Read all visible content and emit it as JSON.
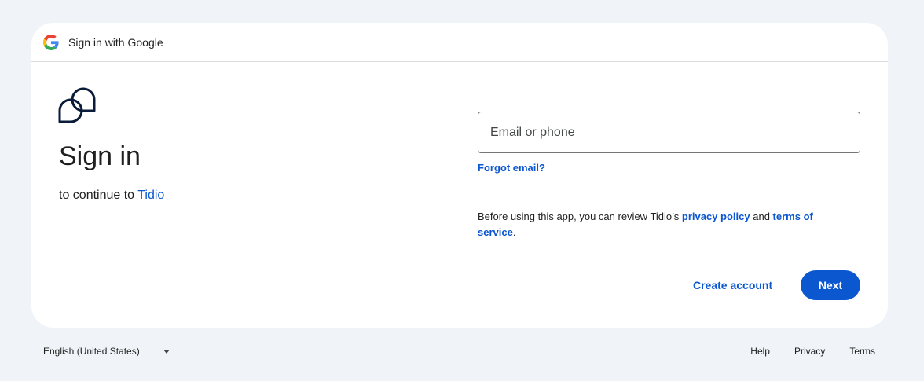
{
  "header": {
    "logo_icon": "google-g-icon",
    "title": "Sign in with Google"
  },
  "left": {
    "app_logo_icon": "tidio-logo-icon",
    "heading": "Sign in",
    "continue_prefix": "to continue to ",
    "app_name": "Tidio"
  },
  "form": {
    "email_placeholder": "Email or phone",
    "email_value": "",
    "forgot_email": "Forgot email?",
    "privacy_prefix": "Before using this app, you can review Tidio’s ",
    "privacy_policy": "privacy policy",
    "privacy_and": " and ",
    "terms_of_service": "terms of service",
    "privacy_suffix": ".",
    "create_account": "Create account",
    "next": "Next"
  },
  "footer": {
    "language": "English (United States)",
    "links": [
      "Help",
      "Privacy",
      "Terms"
    ]
  },
  "colors": {
    "page_background": "#f0f4f9",
    "card_background": "#ffffff",
    "link_blue": "#0b57d0",
    "primary_button": "#0b57d0",
    "text": "#1f1f1f"
  }
}
